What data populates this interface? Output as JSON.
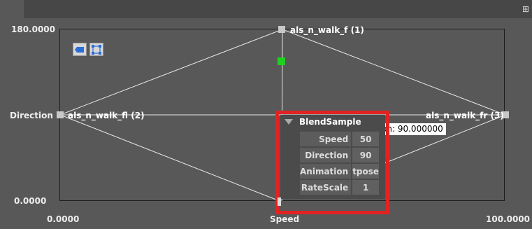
{
  "axes": {
    "y_max": "180.0000",
    "y_min": "0.0000",
    "y_name": "Direction",
    "x_min": "0.0000",
    "x_max": "100.0000",
    "x_name": "Speed"
  },
  "samples": [
    {
      "label": "als_n_walk_f (1)"
    },
    {
      "label": "als_n_walk_fl (2)"
    },
    {
      "label": "als_n_walk_fr (3)"
    }
  ],
  "tooltip_text": "tion: 90.000000",
  "panel": {
    "title": "BlendSample",
    "rows": [
      {
        "name": "Speed",
        "value": "50"
      },
      {
        "name": "Direction",
        "value": "90"
      },
      {
        "name": "Animation",
        "value": "tpose"
      },
      {
        "name": "RateScale",
        "value": "1"
      }
    ]
  },
  "colors": {
    "highlight": "#e12323",
    "preview_point": "#1fd01f",
    "background": "#585858"
  },
  "icons": [
    "tag-icon",
    "select-vertices-icon",
    "window-options-icon"
  ]
}
